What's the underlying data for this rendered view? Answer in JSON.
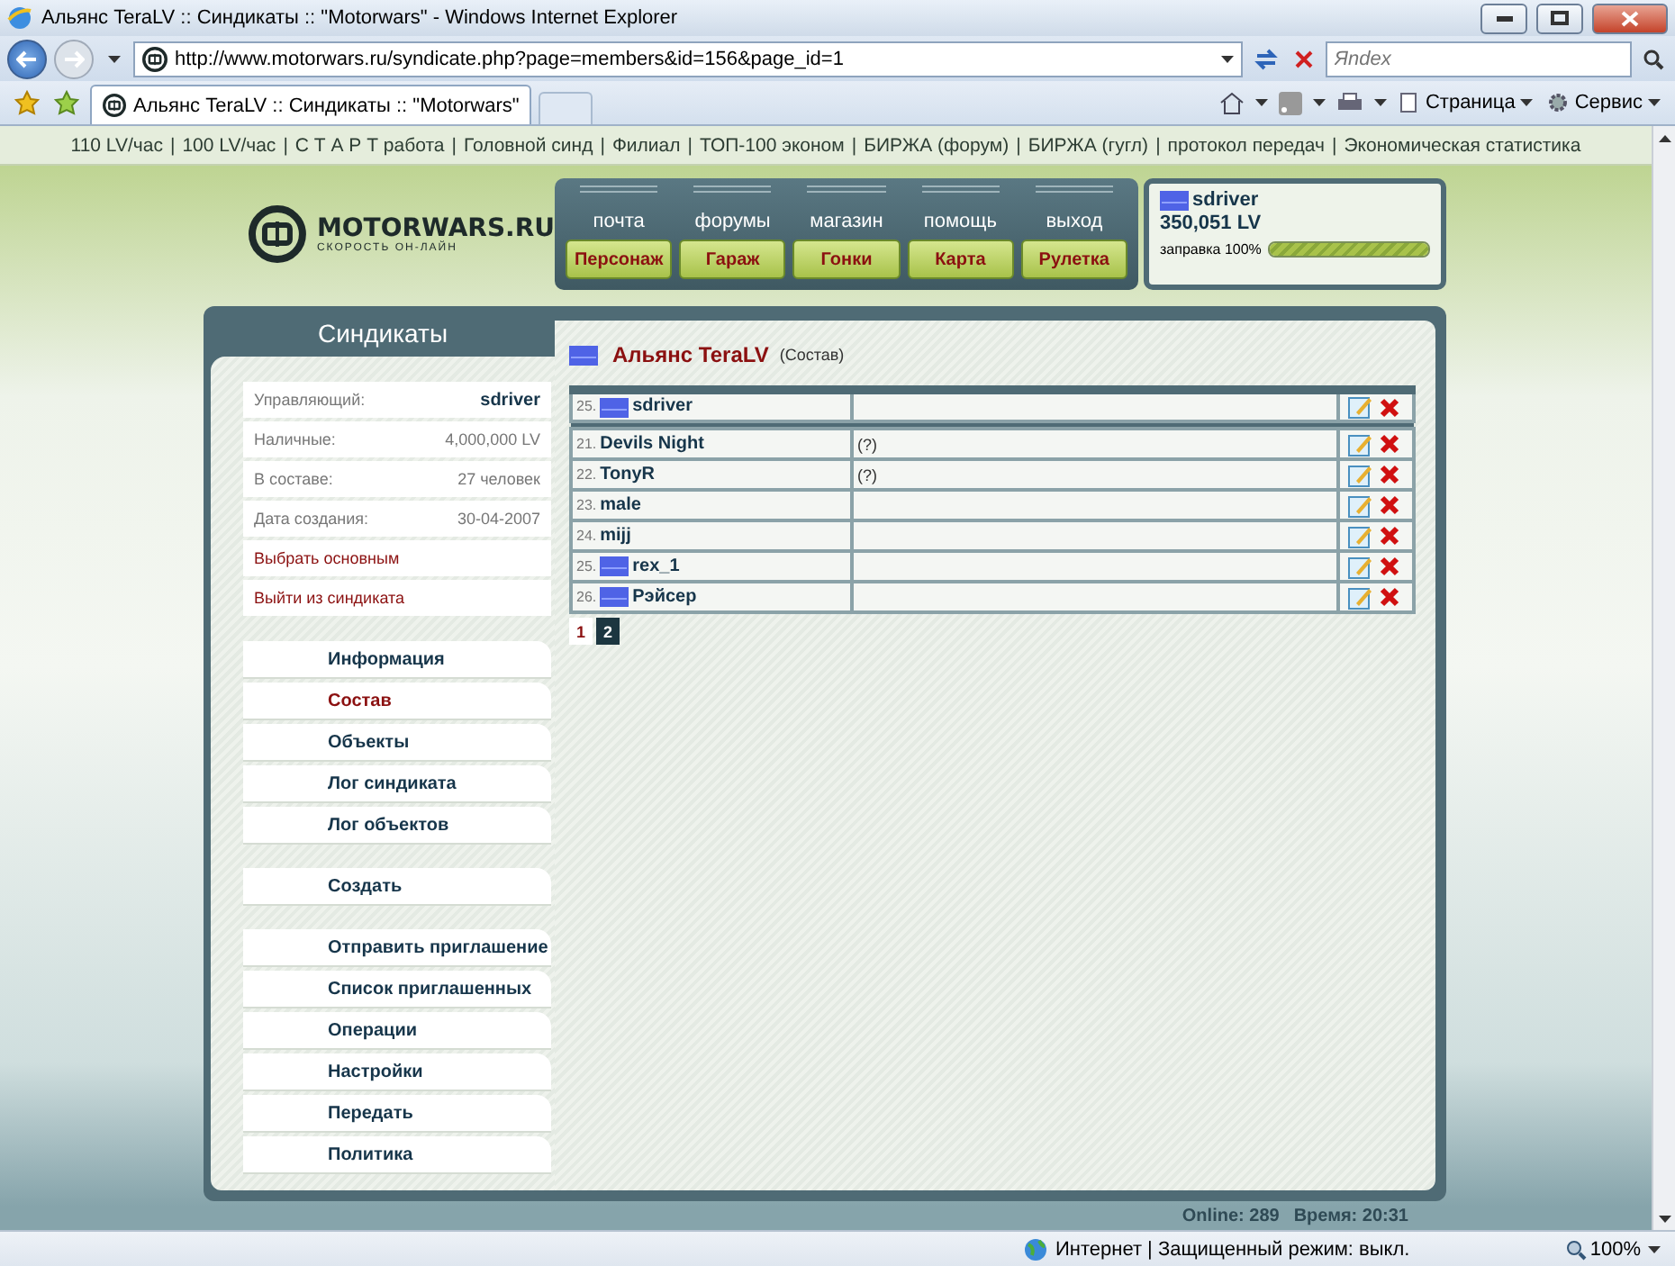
{
  "window": {
    "title": "Альянс TeraLV :: Синдикаты :: \"Motorwars\" - Windows Internet Explorer"
  },
  "address_bar": {
    "url": "http://www.motorwars.ru/syndicate.php?page=members&id=156&page_id=1",
    "placeholder": "Яndex"
  },
  "tabs": [
    {
      "label": "Альянс TeraLV :: Синдикаты :: \"Motorwars\"",
      "selected": true
    }
  ],
  "toolbar": [
    "Страница",
    "Сервис"
  ],
  "top_links_separator": "|",
  "top_links": [
    "110 LV/час",
    "100 LV/час",
    "С Т А Р Т работа",
    "Головной синд",
    "Филиал",
    "ТОП-100 эконом",
    "БИРЖА (форум)",
    "БИРЖА (гугл)",
    "протокол передач",
    "Экономическая статистика"
  ],
  "logo": {
    "name": "MOTORWARS.RU",
    "tagline": "СКОРОСТЬ ОН-ЛАЙН"
  },
  "nav": {
    "links": [
      "почта",
      "форумы",
      "магазин",
      "помощь",
      "выход"
    ],
    "buttons": [
      "Персонаж",
      "Гараж",
      "Гонки",
      "Карта",
      "Рулетка"
    ]
  },
  "user": {
    "name": "sdriver",
    "balance": "350,051 LV",
    "fuel_label": "заправка 100%",
    "level": 1
  },
  "sidebar": {
    "title": "Синдикаты",
    "info": [
      {
        "label": "Управляющий:",
        "value": "sdriver",
        "kind": "user"
      },
      {
        "label": "Наличные:",
        "value": "4,000,000 LV",
        "kind": "plain"
      },
      {
        "label": "В составе:",
        "value": "27 человек",
        "kind": "plain"
      },
      {
        "label": "Дата создания:",
        "value": "30-04-2007",
        "kind": "plain"
      }
    ],
    "actions": [
      "Выбрать основным",
      "Выйти из синдиката"
    ],
    "menu_groups": [
      [
        {
          "label": "Информация",
          "selected": false
        },
        {
          "label": "Состав",
          "selected": true
        },
        {
          "label": "Объекты",
          "selected": false
        },
        {
          "label": "Лог синдиката",
          "selected": false
        },
        {
          "label": "Лог объектов",
          "selected": false
        }
      ],
      [
        {
          "label": "Создать",
          "selected": false
        }
      ],
      [
        {
          "label": "Отправить приглашение",
          "selected": false
        },
        {
          "label": "Список приглашенных",
          "selected": false
        },
        {
          "label": "Операции",
          "selected": false
        },
        {
          "label": "Настройки",
          "selected": false
        },
        {
          "label": "Передать",
          "selected": false
        },
        {
          "label": "Политика",
          "selected": false
        }
      ]
    ]
  },
  "content": {
    "title": "Альянс TeraLV",
    "subtitle": "(Состав)",
    "leader": {
      "number": "25.",
      "name": "sdriver",
      "badge": true
    },
    "rows": [
      {
        "number": "21.",
        "name": "Devils Night",
        "badge": false,
        "note": "(?)"
      },
      {
        "number": "22.",
        "name": "TonyR",
        "badge": false,
        "note": "(?)"
      },
      {
        "number": "23.",
        "name": "male",
        "badge": false
      },
      {
        "number": "24.",
        "name": "mijj",
        "badge": false
      },
      {
        "number": "25.",
        "name": "rex_1",
        "badge": true
      },
      {
        "number": "26.",
        "name": "Рэйсер",
        "badge": true
      }
    ],
    "pages": [
      {
        "label": "1",
        "selected": false
      },
      {
        "label": "2",
        "selected": true
      }
    ]
  },
  "footer": {
    "online": "Online: 289",
    "time": "Время: 20:31"
  },
  "status_bar": {
    "zone": "Интернет | Защищенный режим: выкл.",
    "zoom": "100%"
  }
}
